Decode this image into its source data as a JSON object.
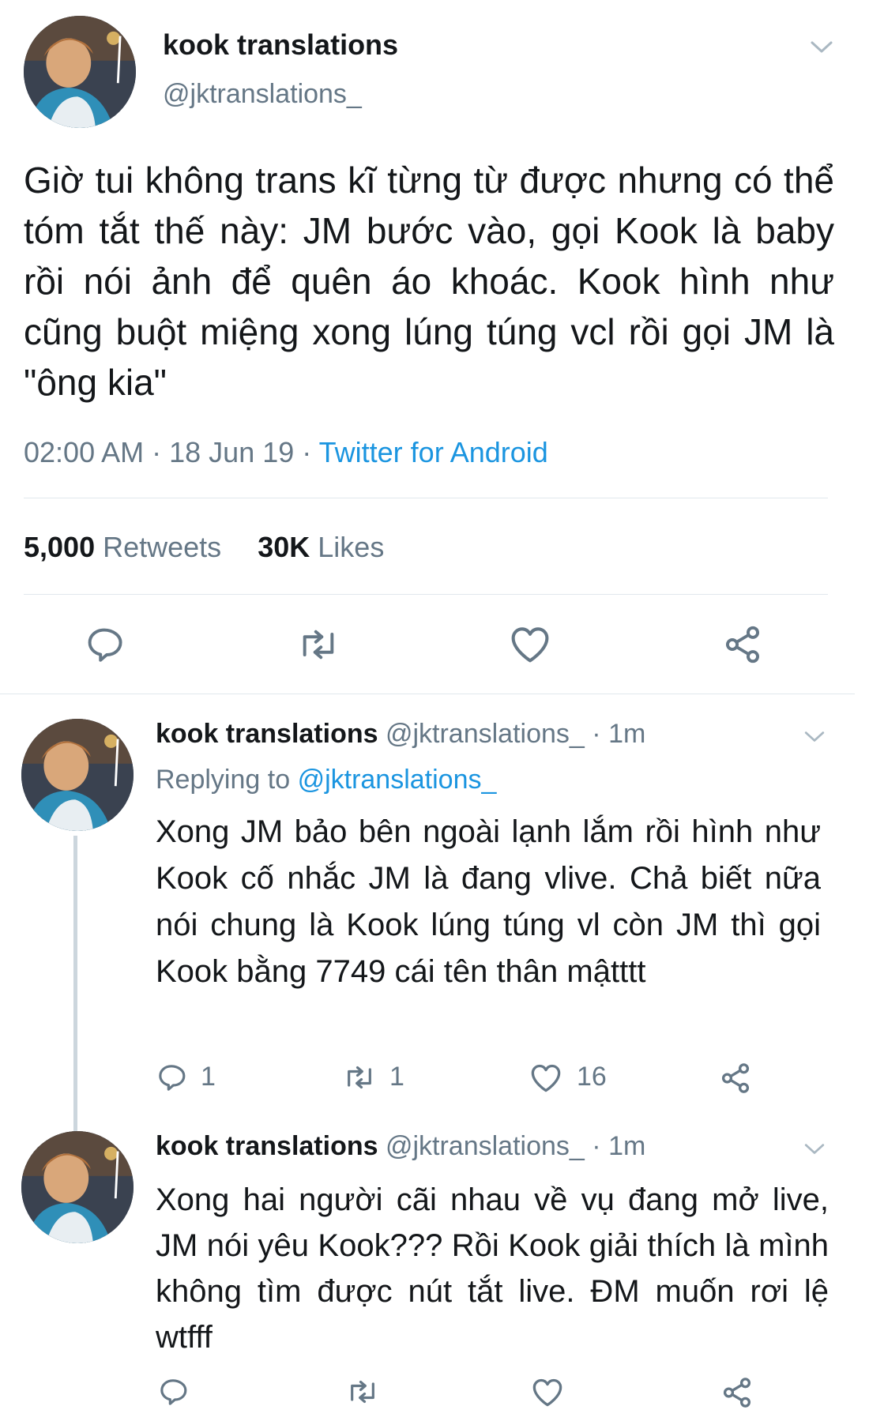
{
  "main_tweet": {
    "display_name": "kook translations",
    "handle": "@jktranslations_",
    "text": "Giờ tui không trans kĩ từng từ được nhưng có thể tóm tắt thế này: JM bước vào, gọi Kook là baby rồi nói ảnh để quên áo khoác. Kook hình như cũng buột miệng xong lúng túng vcl rồi gọi JM là \"ông kia\"",
    "time": "02:00 AM",
    "date": "18 Jun 19",
    "source": "Twitter for Android",
    "retweets_count": "5,000",
    "retweets_label": "Retweets",
    "likes_count": "30K",
    "likes_label": "Likes",
    "sep": "·"
  },
  "replies": [
    {
      "display_name": "kook translations",
      "handle": "@jktranslations_",
      "sep": "·",
      "time": "1m",
      "replying_to_label": "Replying to",
      "replying_to_handle": "@jktranslations_",
      "text": "Xong JM bảo bên ngoài lạnh lắm rồi hình như Kook cố nhắc JM là đang vlive. Chả biết nữa nói chung là Kook lúng túng vl còn JM thì gọi Kook bằng 7749 cái tên thân mậtttt",
      "reply_count": "1",
      "retweet_count": "1",
      "like_count": "16"
    },
    {
      "display_name": "kook translations",
      "handle": "@jktranslations_",
      "sep": "·",
      "time": "1m",
      "text": "Xong hai người cãi nhau về vụ đang mở live, JM nói yêu Kook??? Rồi Kook giải thích là mình không tìm được nút tắt live. ĐM muốn rơi lệ wtfff"
    }
  ],
  "icons": [
    "chevron-down-icon",
    "reply-icon",
    "retweet-icon",
    "like-icon",
    "share-icon"
  ],
  "colors": {
    "link": "#1b95e0",
    "muted": "#657786",
    "text": "#14171a",
    "divider": "#e1e8ed",
    "thread_line": "#ccd6dd"
  }
}
